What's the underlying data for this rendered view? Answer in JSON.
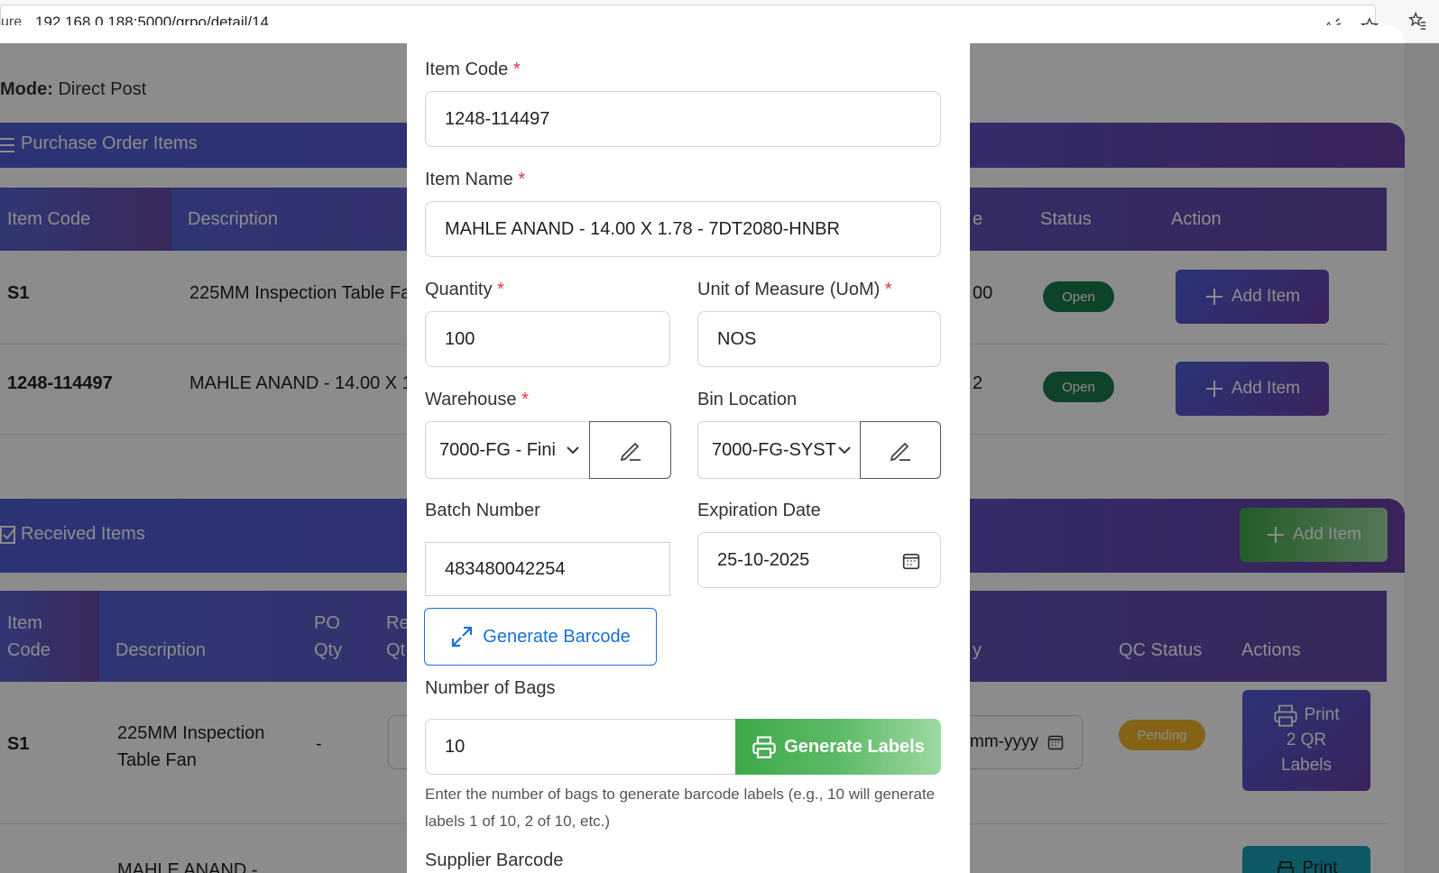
{
  "browser": {
    "url_prefix": "ure",
    "url": "192.168.0.188:5000/grpo/detail/14"
  },
  "background": {
    "mode_label": "Mode:",
    "mode_value": "Direct Post",
    "po_items": {
      "title": "Purchase Order Items",
      "headers": [
        "Item Code",
        "Description",
        "e",
        "Status",
        "Action"
      ],
      "rows": [
        {
          "code": "S1",
          "description": "225MM Inspection Table Fa",
          "qty_tail": "00",
          "status": "Open",
          "action": "Add Item"
        },
        {
          "code": "1248-114497",
          "description": "MAHLE ANAND - 14.00 X 1",
          "qty_tail": "2",
          "status": "Open",
          "action": "Add Item"
        }
      ]
    },
    "received_items": {
      "title": "Received Items",
      "add_button": "Add Item",
      "headers": {
        "item_code_1": "Item",
        "item_code_2": "Code",
        "description": "Description",
        "po_qty_1": "PO",
        "po_qty_2": "Qty",
        "rec_qty_1": "Re",
        "rec_qty_2": "Qt",
        "y": "y",
        "qc_status": "QC Status",
        "actions": "Actions"
      },
      "rows": [
        {
          "code": "S1",
          "description_1": "225MM Inspection",
          "description_2": "Table Fan",
          "po_qty": "-",
          "date_placeholder": "mm-yyyy",
          "qc_status": "Pending",
          "print_1": "Print",
          "print_2": "2 QR",
          "print_3": "Labels"
        },
        {
          "description_1": "MAHLE ANAND -",
          "print_1": "Print"
        }
      ]
    }
  },
  "modal": {
    "item_code": {
      "label": "Item Code",
      "value": "1248-114497"
    },
    "item_name": {
      "label": "Item Name",
      "value": "MAHLE ANAND - 14.00 X 1.78 - 7DT2080-HNBR"
    },
    "quantity": {
      "label": "Quantity",
      "value": "100"
    },
    "uom": {
      "label": "Unit of Measure (UoM)",
      "value": "NOS"
    },
    "warehouse": {
      "label": "Warehouse",
      "value": "7000-FG - Fini"
    },
    "bin_location": {
      "label": "Bin Location",
      "value": "7000-FG-SYST"
    },
    "batch_number": {
      "label": "Batch Number",
      "value": "483480042254"
    },
    "expiration_date": {
      "label": "Expiration Date",
      "value": "25-10-2025"
    },
    "generate_barcode": "Generate Barcode",
    "number_of_bags": {
      "label": "Number of Bags",
      "value": "10"
    },
    "generate_labels": "Generate Labels",
    "help_line1": "Enter the number of bags to generate barcode labels (e.g., 10 will generate",
    "help_line2": "labels 1 of 10, 2 of 10, etc.)",
    "supplier_barcode": {
      "label": "Supplier Barcode"
    },
    "required_mark": "*"
  },
  "colors": {
    "header_gradient_start": "#4f5ed6",
    "header_gradient_end": "#6a3fa6",
    "open_badge": "#1a7a4c",
    "pending_badge": "#f0b429",
    "generate_labels_start": "#3ea84a",
    "generate_labels_end": "#9ed8a2",
    "barcode_blue": "#1a6fd6",
    "required_red": "#dc3545"
  }
}
